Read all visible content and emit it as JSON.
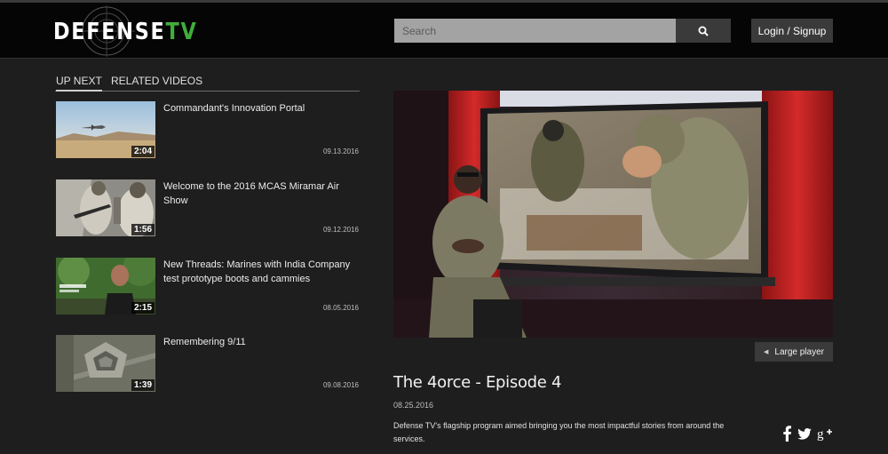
{
  "brand": {
    "logo_main": "DEFENSE",
    "logo_accent": "TV"
  },
  "header": {
    "search_placeholder": "Search",
    "search_icon": "search-icon",
    "login_label": "Login / Signup"
  },
  "tabs": [
    {
      "label": "UP NEXT",
      "active": true
    },
    {
      "label": "RELATED VIDEOS",
      "active": false
    }
  ],
  "videos": [
    {
      "title": "Commandant's Innovation Portal",
      "duration": "2:04",
      "date": "09.13.2016"
    },
    {
      "title": "Welcome to the 2016 MCAS Miramar Air Show",
      "duration": "1:56",
      "date": "09.12.2016"
    },
    {
      "title": "New Threads: Marines with India Company test prototype boots and cammies",
      "duration": "2:15",
      "date": "08.05.2016"
    },
    {
      "title": "Remembering 9/11",
      "duration": "1:39",
      "date": "09.08.2016"
    }
  ],
  "main": {
    "large_player_label": "Large player",
    "title": "The 4orce - Episode 4",
    "date": "08.25.2016",
    "description": "Defense TV's flagship program aimed bringing you the most impactful stories from around the services."
  },
  "social": [
    "facebook-icon",
    "twitter-icon",
    "google-plus-icon"
  ],
  "colors": {
    "background": "#1e1e1e",
    "header": "#050505",
    "accent": "#3fae3a",
    "button": "#3a3a3a"
  }
}
